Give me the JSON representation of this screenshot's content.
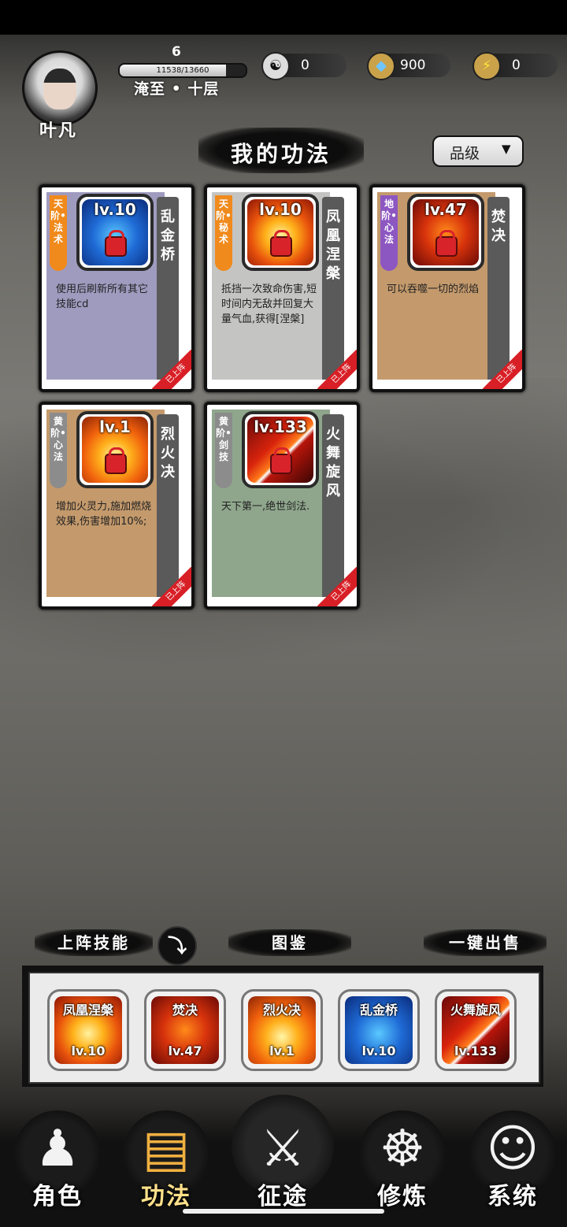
{
  "player": {
    "name": "叶凡",
    "level": "6",
    "exp_text": "11538/13660",
    "exp_fraction": 0.845,
    "realm": "淹至 • 十层"
  },
  "resources": [
    {
      "icon": "yin-yang-icon",
      "value": "0"
    },
    {
      "icon": "spirit-stone-icon",
      "value": "900"
    },
    {
      "icon": "lightning-icon",
      "value": "0"
    }
  ],
  "page_title": "我的功法",
  "sort": {
    "label": "品级"
  },
  "skills": [
    {
      "tier": "天阶•法术",
      "level": "lv.10",
      "name": "乱金桥",
      "desc": "使用后刷新所有其它技能cd",
      "badge": "已上阵"
    },
    {
      "tier": "天阶•秘术",
      "level": "lv.10",
      "name": "凤凰涅槃",
      "desc": "抵挡一次致命伤害,短时间内无敌并回复大量气血,获得[涅槃]",
      "badge": "已上阵"
    },
    {
      "tier": "地阶•心法",
      "level": "lv.47",
      "name": "焚决",
      "desc": "可以吞噬一切的烈焰",
      "badge": "已上阵"
    },
    {
      "tier": "黄阶•心法",
      "level": "lv.1",
      "name": "烈火决",
      "desc": "增加火灵力,施加燃烧效果,伤害增加10%;",
      "badge": "已上阵"
    },
    {
      "tier": "黄阶•剑技",
      "level": "lv.133",
      "name": "火舞旋风",
      "desc": "天下第一,绝世剑法.",
      "badge": "已上阵"
    }
  ],
  "bottom": {
    "deployed_label": "上阵技能",
    "codex_label": "图鉴",
    "sell_label": "一键出售"
  },
  "slots": [
    {
      "name": "凤凰涅槃",
      "level": "lv.10"
    },
    {
      "name": "焚决",
      "level": "lv.47"
    },
    {
      "name": "烈火决",
      "level": "lv.1"
    },
    {
      "name": "乱金桥",
      "level": "lv.10"
    },
    {
      "name": "火舞旋风",
      "level": "lv.133"
    }
  ],
  "nav": [
    {
      "label": "角色",
      "icon": "hooded-figure-icon"
    },
    {
      "label": "功法",
      "icon": "scroll-book-icon",
      "active": true
    },
    {
      "label": "征途",
      "icon": "sword-emblem-icon"
    },
    {
      "label": "修炼",
      "icon": "meditating-figure-icon"
    },
    {
      "label": "系统",
      "icon": "cat-girl-icon"
    }
  ]
}
